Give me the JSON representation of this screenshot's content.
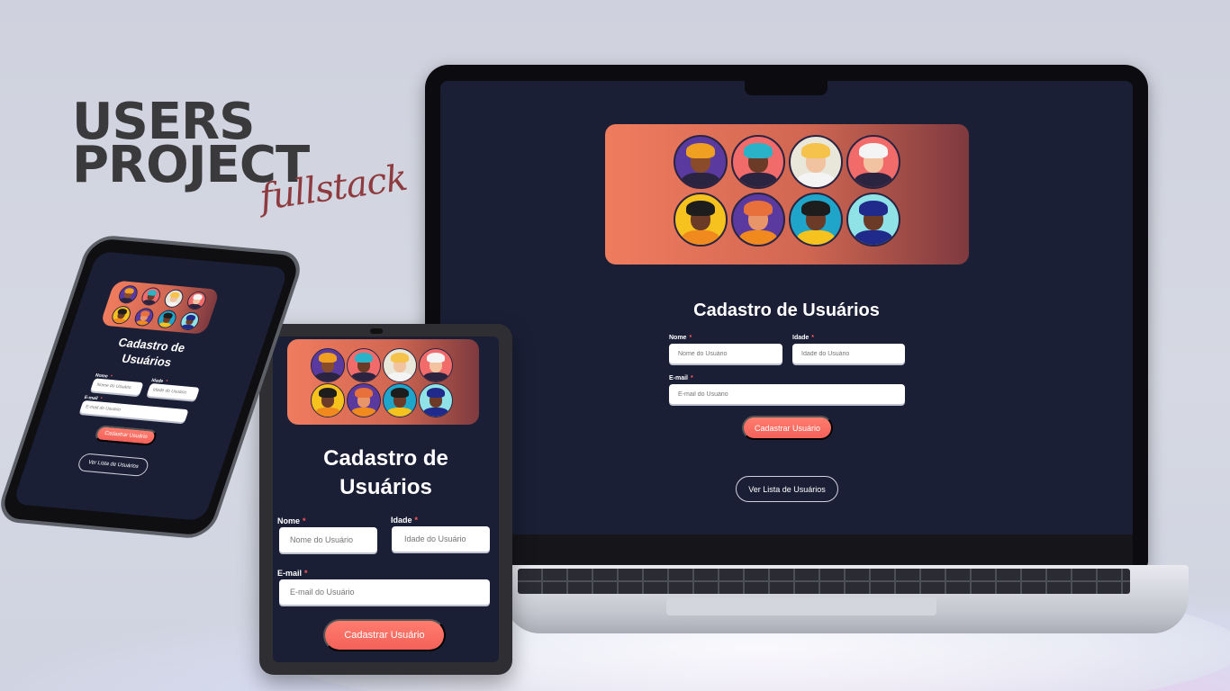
{
  "headline": {
    "line1": "USERS",
    "line2": "PROJECT",
    "script": "fullstack"
  },
  "app": {
    "title": "Cadastro de Usuários",
    "title_line1": "Cadastro de",
    "title_line2": "Usuários",
    "name_label": "Nome",
    "age_label": "Idade",
    "email_label": "E-mail",
    "required_mark": "*",
    "name_placeholder": "Nome do Usuário",
    "age_placeholder": "Idade do Usuário",
    "email_placeholder": "E-mail do Usuário",
    "submit_label": "Cadastrar Usuário",
    "list_label": "Ver Lista de Usuários"
  },
  "colors": {
    "screen_bg": "#1a1f36",
    "accent": "#f4615a",
    "required": "#ff5a5a",
    "banner_start": "#f07c5e",
    "banner_end": "#7e3a3f",
    "headline": "#3a3a3c",
    "script": "#8e3b3f"
  },
  "avatars": [
    {
      "name": "avatar-woman-curly-icon",
      "bg": "#5b3aa0",
      "skin": "#8a4b2a",
      "hair": "#f0a020",
      "shirt": "#2b2440"
    },
    {
      "name": "avatar-woman-cap-icon",
      "bg": "#f26b6b",
      "skin": "#6b3b28",
      "hair": "#2ab3c8",
      "shirt": "#2b2440"
    },
    {
      "name": "avatar-woman-blonde-icon",
      "bg": "#e9e6da",
      "skin": "#f2c3a0",
      "hair": "#f5c24a",
      "shirt": "#f4f4f4"
    },
    {
      "name": "avatar-man-white-hair-icon",
      "bg": "#f26b6b",
      "skin": "#f2c3a0",
      "hair": "#f4f4f4",
      "shirt": "#2b2440"
    },
    {
      "name": "avatar-man-glasses-icon",
      "bg": "#f5c21e",
      "skin": "#6b3b28",
      "hair": "#1d1d1d",
      "shirt": "#f08a1e"
    },
    {
      "name": "avatar-man-beard-icon",
      "bg": "#5b3aa0",
      "skin": "#e8956a",
      "hair": "#e8703a",
      "shirt": "#f08a1e"
    },
    {
      "name": "avatar-man-jacket-icon",
      "bg": "#1fa5c9",
      "skin": "#6b3b28",
      "hair": "#1d1d1d",
      "shirt": "#f5c21e"
    },
    {
      "name": "avatar-man-afro-icon",
      "bg": "#8fe2e6",
      "skin": "#6b3b28",
      "hair": "#1f2a8a",
      "shirt": "#1f2a8a"
    }
  ]
}
